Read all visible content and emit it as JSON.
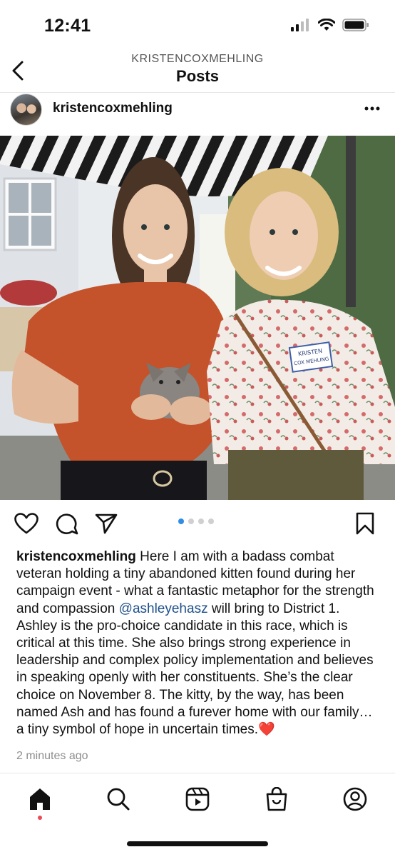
{
  "status_bar": {
    "time": "12:41"
  },
  "header": {
    "account": "KRISTENCOXMEHLING",
    "title": "Posts"
  },
  "post": {
    "username": "kristencoxmehling",
    "name_tag": "KRISTEN COX MEHLING",
    "carousel": {
      "total": 4,
      "current": 1
    },
    "caption": {
      "author": "kristencoxmehling",
      "part1": " Here I am with a badass combat veteran holding a tiny abandoned kitten found during her campaign event - what a fantastic metaphor for the strength and compassion ",
      "mention": "@ashleyehasz",
      "part2": " will bring to District 1. Ashley is the pro-choice candidate in this race, which is critical at this time. She also brings strong experience in leadership and complex policy implementation and believes in speaking openly with her constituents. She’s the clear choice on November 8.  The kitty, by the way, has been named Ash and has found a furever home with our family… a tiny symbol of hope in uncertain times.",
      "emoji": "❤️"
    },
    "timestamp": "2 minutes ago"
  },
  "icons": {
    "back": "chevron-left-icon",
    "more": "ellipsis-icon",
    "like": "heart-icon",
    "comment": "comment-icon",
    "share": "paper-plane-icon",
    "save": "bookmark-icon",
    "nav": [
      "home-icon",
      "search-icon",
      "reels-icon",
      "shop-icon",
      "profile-icon"
    ]
  },
  "colors": {
    "link": "#1d4f8a",
    "carousel_active": "#2f8de4",
    "notification": "#ed4956"
  }
}
